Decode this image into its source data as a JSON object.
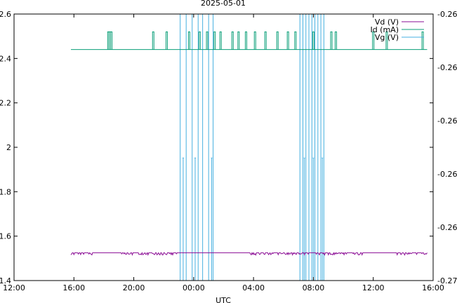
{
  "chart_data": {
    "type": "line",
    "title": "2025-05-01",
    "xlabel": "UTC",
    "ylabel": "",
    "y2label": "",
    "x_ticks": [
      "12:00",
      "16:00",
      "20:00",
      "00:00",
      "04:00",
      "08:00",
      "12:00",
      "16:00"
    ],
    "x_range_hours": [
      0,
      28
    ],
    "ylim": [
      1.4,
      2.6
    ],
    "y_ticks": [
      1.4,
      1.6,
      1.8,
      2,
      2.2,
      2.4,
      2.6
    ],
    "y2lim": [
      -0.27,
      -0.26
    ],
    "y2_ticks": [
      -0.27,
      -0.268,
      -0.266,
      -0.264,
      -0.262,
      -0.26
    ],
    "grid": false,
    "legend_position": "top-right",
    "series": [
      {
        "name": "Vd (V)",
        "axis": "y",
        "color": "#8b0d95",
        "baseline": 1.525,
        "x_range": [
          3.8,
          27.6
        ],
        "noise_segments": [
          [
            3.8,
            5.2
          ],
          [
            7.0,
            11.0
          ],
          [
            15.8,
            23.3
          ],
          [
            25.5,
            27.6
          ]
        ],
        "noise_amplitude": 0.01
      },
      {
        "name": "Id (mA)",
        "axis": "y",
        "color": "#099e77",
        "baseline": 2.44,
        "spike_value": 2.52,
        "x_range": [
          3.8,
          27.6
        ],
        "spikes": [
          6.3,
          6.4,
          6.5,
          9.3,
          10.2,
          11.7,
          12.4,
          12.9,
          13.4,
          13.8,
          14.6,
          15.0,
          15.5,
          16.1,
          16.8,
          17.6,
          18.3,
          18.8,
          20.0,
          21.2,
          21.5,
          24.0,
          24.9,
          27.3
        ]
      },
      {
        "name": "Vg (V)",
        "axis": "y2",
        "color": "#46b0e0",
        "baseline_off_chart": true,
        "spikes_full": [
          11.1,
          11.5,
          11.9,
          12.3,
          12.6,
          13.0,
          13.3,
          19.1,
          19.3,
          19.5,
          19.7,
          19.9,
          20.1,
          20.3,
          20.5,
          20.7
        ],
        "spikes_mid": [
          11.3,
          12.1,
          13.2,
          19.4,
          20.0,
          20.6
        ],
        "mid_value": -0.2654
      }
    ]
  }
}
